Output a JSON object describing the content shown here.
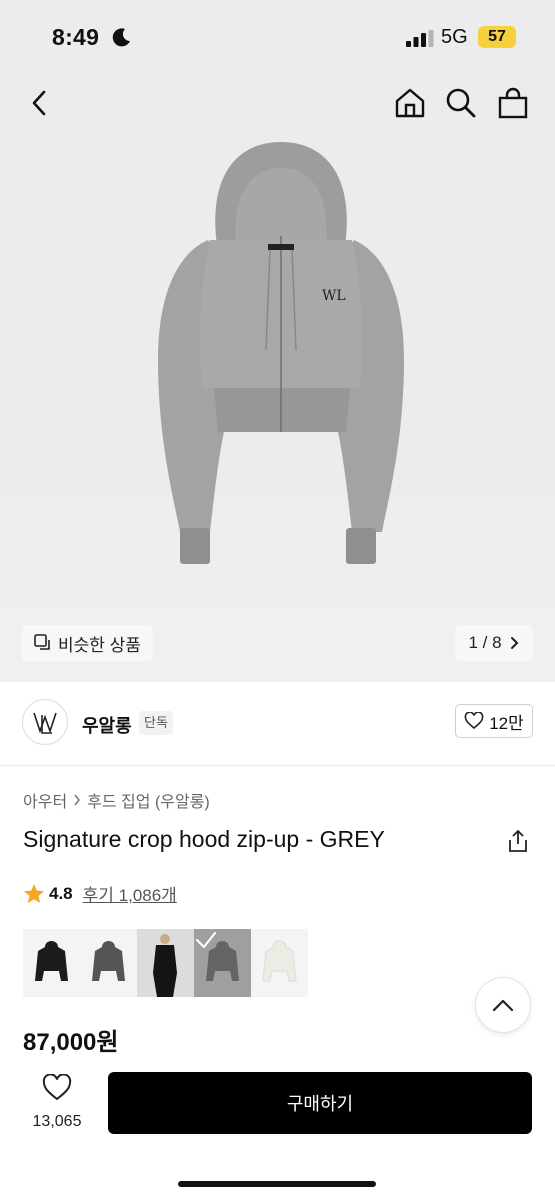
{
  "status_bar": {
    "time": "8:49",
    "network": "5G",
    "battery": "57"
  },
  "nav": {
    "icons": [
      "back-icon",
      "home-icon",
      "search-icon",
      "shopping-bag-icon"
    ]
  },
  "hero": {
    "similar_label": "비슷한 상품",
    "pager": "1 / 8"
  },
  "brand": {
    "name": "우알롱",
    "badge": "단독",
    "likes": "12만"
  },
  "product": {
    "breadcrumb": [
      "아우터",
      "후드 집업 (우알롱)"
    ],
    "title": "Signature crop hood zip-up - GREY",
    "rating": "4.8",
    "review_label": "후기 1,086개",
    "price": "87,000원"
  },
  "swatches": [
    "black",
    "charcoal",
    "model-black",
    "grey",
    "ivory"
  ],
  "colors": {
    "accent": "#000000",
    "star": "#f5a623",
    "badge_bg": "#f6d13d"
  },
  "bottom": {
    "wish_count": "13,065",
    "buy_label": "구매하기"
  }
}
